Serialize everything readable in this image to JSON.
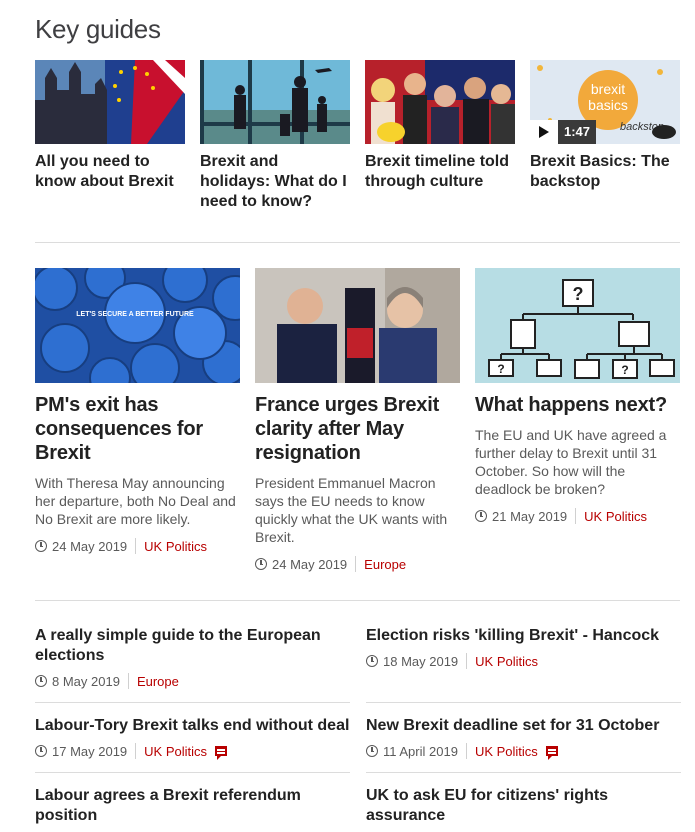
{
  "section_title": "Key guides",
  "guides": [
    {
      "title": "All you need to know about Brexit",
      "video": false
    },
    {
      "title": "Brexit and holidays: What do I need to know?",
      "video": false
    },
    {
      "title": "Brexit timeline told through culture",
      "video": false
    },
    {
      "title": "Brexit Basics: The backstop",
      "video": true,
      "duration": "1:47",
      "image_text": [
        "brexit",
        "basics",
        "backstop"
      ]
    }
  ],
  "featured": [
    {
      "title": "PM's exit has consequences for Brexit",
      "summary": "With Theresa May announcing her departure, both No Deal and No Brexit are more likely.",
      "date": "24 May 2019",
      "tag": "UK Politics",
      "image_text": [
        "LET'S SECURE A BETTER FUTURE"
      ]
    },
    {
      "title": "France urges Brexit clarity after May resignation",
      "summary": "President Emmanuel Macron says the EU needs to know quickly what the UK wants with Brexit.",
      "date": "24 May 2019",
      "tag": "Europe"
    },
    {
      "title": "What happens next?",
      "summary": "The EU and UK have agreed a further delay to Brexit until 31 October. So how will the deadlock be broken?",
      "date": "21 May 2019",
      "tag": "UK Politics"
    }
  ],
  "list": [
    {
      "title": "A really simple guide to the European elections",
      "date": "8 May 2019",
      "tag": "Europe",
      "comments": false
    },
    {
      "title": "Election risks 'killing Brexit' - Hancock",
      "date": "18 May 2019",
      "tag": "UK Politics",
      "comments": false
    },
    {
      "title": "Labour-Tory Brexit talks end without deal",
      "date": "17 May 2019",
      "tag": "UK Politics",
      "comments": true
    },
    {
      "title": "New Brexit deadline set for 31 October",
      "date": "11 April 2019",
      "tag": "UK Politics",
      "comments": true
    },
    {
      "title": "Labour agrees a Brexit referendum position",
      "date": "",
      "tag": "",
      "comments": false
    },
    {
      "title": "UK to ask EU for citizens' rights assurance",
      "date": "",
      "tag": "",
      "comments": false
    }
  ],
  "colors": {
    "accent": "#b80000",
    "text": "#222222",
    "meta": "#5a5a5a",
    "rule": "#dcdcdc"
  }
}
